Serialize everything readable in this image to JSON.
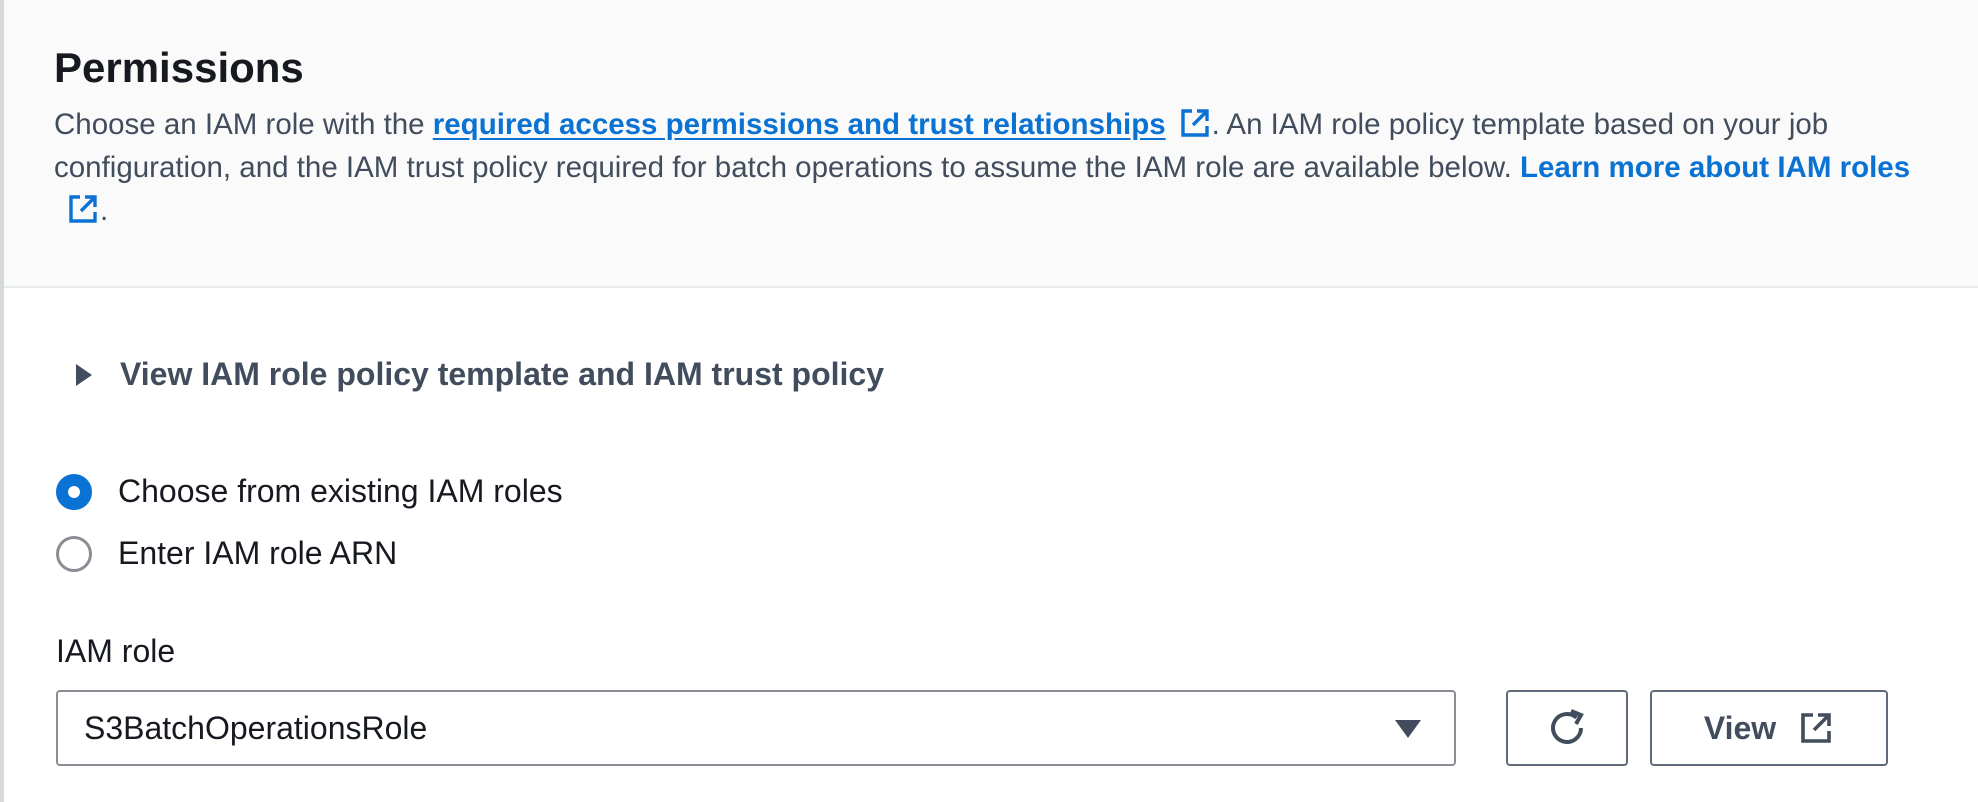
{
  "header": {
    "title": "Permissions",
    "desc_part1": "Choose an IAM role with the ",
    "link_permissions": "required access permissions and trust relationships",
    "desc_part2": ". An IAM role policy template based on your job configuration, and the IAM trust policy required for batch operations to assume the IAM role are available below. ",
    "link_learn_more": "Learn more about IAM roles",
    "desc_part3": "."
  },
  "expander": {
    "label": "View IAM role policy template and IAM trust policy",
    "expanded": false
  },
  "role_choice": {
    "options": [
      {
        "label": "Choose from existing IAM roles",
        "selected": true
      },
      {
        "label": "Enter IAM role ARN",
        "selected": false
      }
    ]
  },
  "iam_role": {
    "label": "IAM role",
    "value": "S3BatchOperationsRole"
  },
  "buttons": {
    "view_label": "View"
  },
  "icons": {
    "external": "external-link-icon",
    "refresh": "refresh-icon",
    "caret_right": "caret-right-icon",
    "caret_down": "caret-down-icon"
  },
  "colors": {
    "link": "#0972d3",
    "radio_selected": "#0972d3",
    "text": "#16191f",
    "secondary_text": "#414d5c",
    "header_bg": "#fafafa"
  }
}
